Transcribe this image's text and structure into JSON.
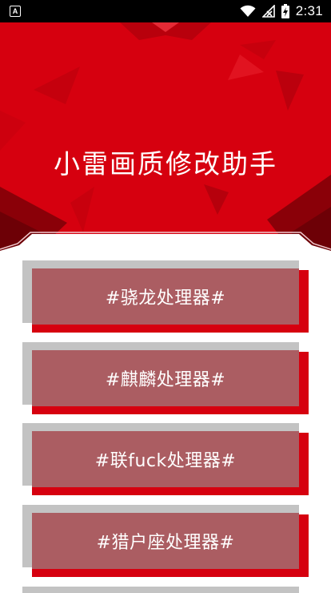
{
  "status_bar": {
    "time": "2:31",
    "app_badge": "A",
    "icons": [
      "wifi-icon",
      "signal-icon",
      "battery-charging-icon"
    ]
  },
  "header": {
    "title": "小雷画质修改助手"
  },
  "options": [
    {
      "label": "#骁龙处理器#"
    },
    {
      "label": "#麒麟处理器#"
    },
    {
      "label": "#联fuck处理器#"
    },
    {
      "label": "#猎户座处理器#"
    }
  ],
  "colors": {
    "brand_red": "#d6000f",
    "card_face": "#ab5d62",
    "card_gray": "#c3c3c3",
    "status_bar": "#000000"
  }
}
